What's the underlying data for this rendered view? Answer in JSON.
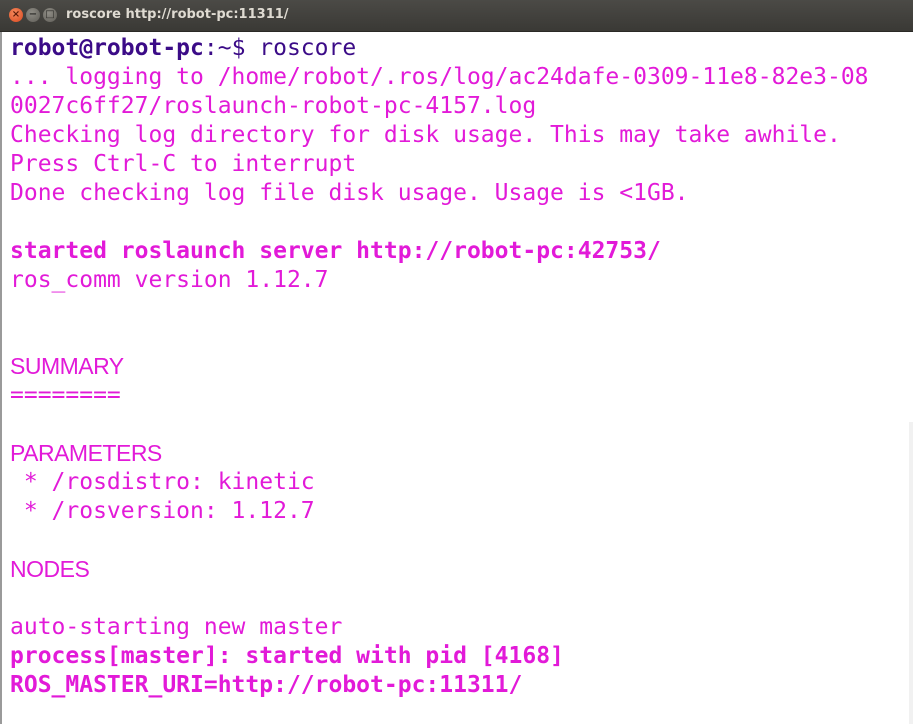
{
  "window": {
    "title": "roscore http://robot-pc:11311/",
    "close_glyph": "×",
    "minimize_glyph": "−",
    "maximize_glyph": "□"
  },
  "prompt": {
    "user_host": "robot@robot-pc",
    "path": ":~$",
    "command": " roscore"
  },
  "lines": {
    "l1": "... logging to /home/robot/.ros/log/ac24dafe-0309-11e8-82e3-08",
    "l2": "0027c6ff27/roslaunch-robot-pc-4157.log",
    "l3": "Checking log directory for disk usage. This may take awhile.",
    "l4": "Press Ctrl-C to interrupt",
    "l5": "Done checking log file disk usage. Usage is <1GB.",
    "l6": "started roslaunch server http://robot-pc:42753/",
    "l7": "ros_comm version 1.12.7",
    "summary": "SUMMARY",
    "rule": "========",
    "parameters": "PARAMETERS",
    "param1": " * /rosdistro: kinetic",
    "param2": " * /rosversion: 1.12.7",
    "nodes": "NODES",
    "l8": "auto-starting new master",
    "l9": "process[master]: started with pid [4168]",
    "l10": "ROS_MASTER_URI=http://robot-pc:11311/"
  },
  "colors": {
    "output": "#e21ad8",
    "prompt": "#3b0b87",
    "titlebar": "#3f3e3a"
  }
}
